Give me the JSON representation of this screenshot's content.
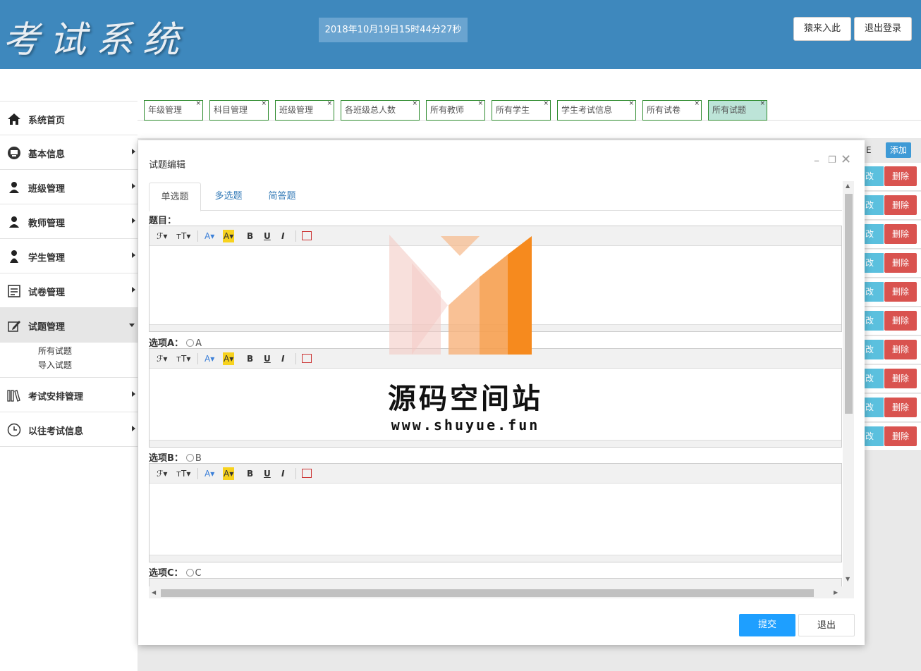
{
  "header": {
    "logo_text": "考试系统",
    "clock": "2018年10月19日15时44分27秒",
    "btn_enter": "猿来入此",
    "btn_logout": "退出登录"
  },
  "sidebar": {
    "items": [
      {
        "label": "系统首页",
        "icon": "home-icon"
      },
      {
        "label": "基本信息",
        "icon": "monitor-icon"
      },
      {
        "label": "班级管理",
        "icon": "user-icon"
      },
      {
        "label": "教师管理",
        "icon": "user-icon"
      },
      {
        "label": "学生管理",
        "icon": "user-icon"
      },
      {
        "label": "试卷管理",
        "icon": "document-icon"
      },
      {
        "label": "试题管理",
        "icon": "edit-icon"
      },
      {
        "label": "考试安排管理",
        "icon": "books-icon"
      },
      {
        "label": "以往考试信息",
        "icon": "clock-icon"
      }
    ],
    "sub_items": [
      "所有试题",
      "导入试题"
    ]
  },
  "tabs": [
    "年级管理",
    "科目管理",
    "班级管理",
    "各班级总人数",
    "所有教师",
    "所有学生",
    "学生考试信息",
    "所有试卷",
    "所有试题"
  ],
  "table": {
    "header_partial": "E",
    "add_label": "添加",
    "edit_label": "修改",
    "delete_label": "删除",
    "row_count": 10
  },
  "modal": {
    "title": "试题编辑",
    "tabs": [
      "单选题",
      "多选题",
      "简答题"
    ],
    "question_label": "题目：",
    "options": [
      {
        "label": "选项A：",
        "value": "A"
      },
      {
        "label": "选项B：",
        "value": "B"
      },
      {
        "label": "选项C：",
        "value": "C"
      }
    ],
    "toolbar": {
      "font": "ℱ▾",
      "size": "ᴛT▾",
      "color": "A▾",
      "bgcolor": "A▾",
      "bold": "B",
      "underline": "U",
      "italic": "I"
    },
    "submit_label": "提交",
    "exit_label": "退出"
  },
  "watermark": {
    "title": "源码空间站",
    "url": "www.shuyue.fun"
  },
  "colors": {
    "header_bg": "#3e88bd",
    "primary": "#1e9fff",
    "danger": "#d9534f",
    "info": "#5bc0de",
    "tab_border": "#2e8b2e",
    "watermark_orange": "#f68a1e"
  }
}
